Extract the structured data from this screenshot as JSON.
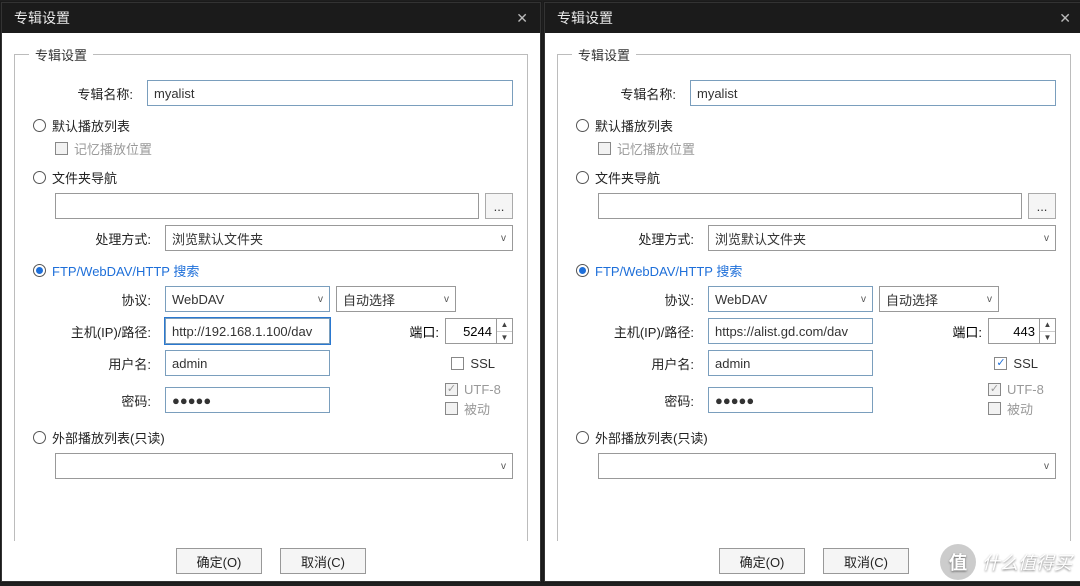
{
  "window_title": "专辑设置",
  "group_legend": "专辑设置",
  "labels": {
    "album_name": "专辑名称:",
    "default_playlist": "默认播放列表",
    "remember_pos": "记忆播放位置",
    "folder_nav": "文件夹导航",
    "handle_method": "处理方式:",
    "handle_value": "浏览默认文件夹",
    "ftp_search": "FTP/WebDAV/HTTP 搜索",
    "protocol": "协议:",
    "auto_select": "自动选择",
    "host": "主机(IP)/路径:",
    "port": "端口:",
    "user": "用户名:",
    "password": "密码:",
    "ssl": "SSL",
    "utf8": "UTF-8",
    "passive": "被动",
    "ext_playlist": "外部播放列表(只读)",
    "ok": "确定(O)",
    "cancel": "取消(C)",
    "browse": "..."
  },
  "left": {
    "album_name": "myalist",
    "protocol": "WebDAV",
    "host": "http://192.168.1.100/dav",
    "port": "5244",
    "user": "admin",
    "password": "●●●●●",
    "ssl_checked": false
  },
  "right": {
    "album_name": "myalist",
    "protocol": "WebDAV",
    "host": "https://alist.gd.com/dav",
    "port": "443",
    "user": "admin",
    "password": "●●●●●",
    "ssl_checked": true
  },
  "watermark": {
    "badge": "值",
    "text": "什么值得买"
  }
}
